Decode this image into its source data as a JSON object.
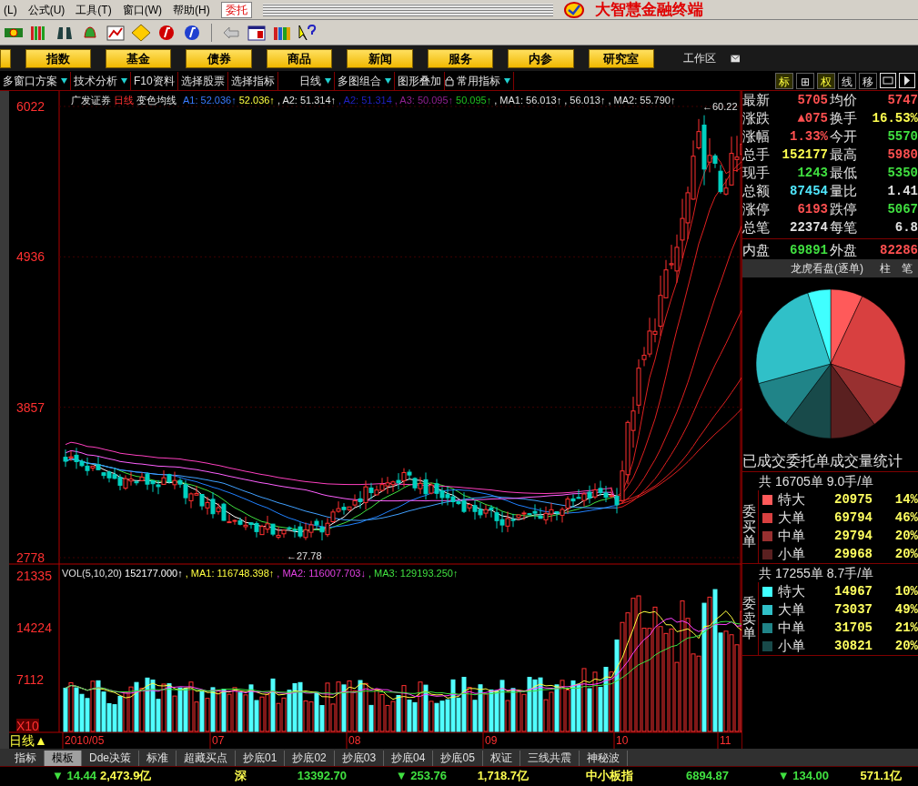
{
  "menu": {
    "items": [
      "(L)",
      "公式(U)",
      "工具(T)",
      "窗口(W)",
      "帮助(H)"
    ],
    "trade_button": "委托",
    "app_title": "大智慧金融终端"
  },
  "nav_buttons": [
    "指数",
    "基金",
    "债券",
    "商品",
    "新闻",
    "服务",
    "内参",
    "研究室"
  ],
  "workspace": {
    "label": "工作区"
  },
  "options_bar": [
    {
      "label": "多窗口方案",
      "dropdown": true
    },
    {
      "label": "技术分析",
      "dropdown": true
    },
    {
      "label": "F10资料",
      "dropdown": false
    },
    {
      "label": "选择股票",
      "dropdown": false
    },
    {
      "label": "选择指标",
      "dropdown": false
    },
    {
      "label": "日线",
      "dropdown": true
    },
    {
      "label": "多图组合",
      "dropdown": true
    },
    {
      "label": "图形叠加",
      "dropdown": false
    },
    {
      "label": "常用指标",
      "dropdown": true
    }
  ],
  "view_buttons": [
    {
      "label": "标",
      "active": true
    },
    {
      "label": "⊞",
      "active": false
    },
    {
      "label": "权",
      "active": true
    },
    {
      "label": "线",
      "active": false
    },
    {
      "label": "移",
      "active": false
    }
  ],
  "chart": {
    "stock": "广发证券",
    "period": "日线",
    "indicator": "变色均线",
    "price_header": [
      {
        "text": "A1: 52.036↑",
        "color": "#3a7bff"
      },
      {
        "text": "52.036↑",
        "color": "#ffff40"
      },
      {
        "text": ", A2: 51.314↑",
        "color": "#e0e0e0"
      },
      {
        "text": ", A2: 51.314",
        "color": "#2020c0"
      },
      {
        "text": ", A3: 50.095↑",
        "color": "#902090"
      },
      {
        "text": "50.095↑",
        "color": "#20c020"
      },
      {
        "text": ", MA1: 56.013↑",
        "color": "#e0e0e0"
      },
      {
        "text": ", 56.013↑",
        "color": "#e0e0e0"
      },
      {
        "text": ", MA2: 55.790↑",
        "color": "#e0e0e0"
      }
    ],
    "price_ticks": [
      "6022",
      "4936",
      "3857",
      "2778"
    ],
    "high_label": "←60.22",
    "low_label": "←27.78",
    "volume_header": [
      {
        "text": "VOL(5,10,20)",
        "color": "#e0e0e0"
      },
      {
        "text": "152177.000↑",
        "color": "#ffffff"
      },
      {
        "text": ", MA1: 116748.398↑",
        "color": "#ffff40"
      },
      {
        "text": ", MA2: 116007.703↓",
        "color": "#e040e0"
      },
      {
        "text": ", MA3: 129193.250↑",
        "color": "#40e040"
      }
    ],
    "volume_ticks": [
      "21335",
      "14224",
      "7112",
      "X10"
    ],
    "period_label": "日线▲",
    "date_labels": [
      "2010/05",
      "07",
      "08",
      "09",
      "10",
      "11"
    ]
  },
  "quote": {
    "rows": [
      {
        "cells": [
          {
            "label": "最新",
            "value": "5705",
            "color": "#ff5050"
          },
          {
            "label": "均价",
            "value": "5747",
            "color": "#ff5050"
          }
        ]
      },
      {
        "cells": [
          {
            "label": "涨跌",
            "value": "▲075",
            "color": "#ff5050"
          },
          {
            "label": "换手",
            "value": "16.53%",
            "color": "#ffff50"
          }
        ]
      },
      {
        "cells": [
          {
            "label": "涨幅",
            "value": "1.33%",
            "color": "#ff5050"
          },
          {
            "label": "今开",
            "value": "5570",
            "color": "#40e040"
          }
        ]
      },
      {
        "cells": [
          {
            "label": "总手",
            "value": "152177",
            "color": "#ffff50"
          },
          {
            "label": "最高",
            "value": "5980",
            "color": "#ff5050"
          }
        ]
      },
      {
        "cells": [
          {
            "label": "现手",
            "value": "1243",
            "color": "#40e040"
          },
          {
            "label": "最低",
            "value": "5350",
            "color": "#40e040"
          }
        ]
      },
      {
        "cells": [
          {
            "label": "总额",
            "value": "87454",
            "color": "#50e8ff"
          },
          {
            "label": "量比",
            "value": "1.41",
            "color": "#e0e0e0"
          }
        ]
      },
      {
        "cells": [
          {
            "label": "涨停",
            "value": "6193",
            "color": "#ff5050"
          },
          {
            "label": "跌停",
            "value": "5067",
            "color": "#40e040"
          }
        ]
      },
      {
        "cells": [
          {
            "label": "总笔",
            "value": "22374",
            "color": "#e0e0e0"
          },
          {
            "label": "每笔",
            "value": "6.8",
            "color": "#e0e0e0"
          }
        ]
      },
      {
        "cells": [
          {
            "label": "内盘",
            "value": "69891",
            "color": "#40e040"
          },
          {
            "label": "外盘",
            "value": "82286",
            "color": "#ff5050"
          }
        ]
      }
    ]
  },
  "order_panel": {
    "title": "龙虎看盘(逐单)",
    "tabs": [
      {
        "label": "柱",
        "selected": false
      },
      {
        "label": "笔",
        "selected": false
      }
    ],
    "chart_data": {
      "type": "pie",
      "values": [
        6.97,
        23.18,
        9.9,
        9.95,
        10.24,
        10.53,
        24.26,
        4.97
      ]
    },
    "stats_title": "已成交委托单成交量统计",
    "sections": [
      {
        "side": "委买单",
        "summary": "共 16705单 9.0手/单",
        "rows": [
          {
            "name": "特大",
            "volume": "20975",
            "share": "14%",
            "color": "#ff5a5a"
          },
          {
            "name": "大单",
            "volume": "69794",
            "share": "46%",
            "color": "#d84040"
          },
          {
            "name": "中单",
            "volume": "29794",
            "share": "20%",
            "color": "#983030"
          },
          {
            "name": "小单",
            "volume": "29968",
            "share": "20%",
            "color": "#5a2020"
          }
        ]
      },
      {
        "side": "委卖单",
        "summary": "共 17255单 8.7手/单",
        "rows": [
          {
            "name": "特大",
            "volume": "14967",
            "share": "10%",
            "color": "#40ffff"
          },
          {
            "name": "大单",
            "volume": "73037",
            "share": "49%",
            "color": "#30c0c8"
          },
          {
            "name": "中单",
            "volume": "31705",
            "share": "21%",
            "color": "#208488"
          },
          {
            "name": "小单",
            "volume": "30821",
            "share": "20%",
            "color": "#184a4a"
          }
        ]
      }
    ]
  },
  "bottom_tabs": [
    {
      "label": "指标",
      "selected": false
    },
    {
      "label": "模板",
      "selected": true
    },
    {
      "label": "Dde决策",
      "selected": false
    },
    {
      "label": "标准",
      "selected": false
    },
    {
      "label": "超藏买点",
      "selected": false
    },
    {
      "label": "抄底01",
      "selected": false
    },
    {
      "label": "抄底02",
      "selected": false
    },
    {
      "label": "抄底03",
      "selected": false
    },
    {
      "label": "抄底04",
      "selected": false
    },
    {
      "label": "抄底05",
      "selected": false
    },
    {
      "label": "权证",
      "selected": false
    },
    {
      "label": "三线共震",
      "selected": false
    },
    {
      "label": "神秘波",
      "selected": false
    }
  ],
  "status_bar": [
    {
      "text": "▼ 14.44",
      "color": "#40e040"
    },
    {
      "text": "2,473.9亿",
      "color": "#ffff50"
    },
    {
      "text": "深",
      "color": "#ffff50"
    },
    {
      "text": "13392.70",
      "color": "#40e040"
    },
    {
      "text": "▼ 253.76",
      "color": "#40e040"
    },
    {
      "text": "1,718.7亿",
      "color": "#ffff50"
    },
    {
      "text": "中小板指",
      "color": "#ffff50"
    },
    {
      "text": "6894.87",
      "color": "#40e040"
    },
    {
      "text": "▼ 134.00",
      "color": "#40e040"
    },
    {
      "text": "571.1亿",
      "color": "#ffff50"
    }
  ]
}
